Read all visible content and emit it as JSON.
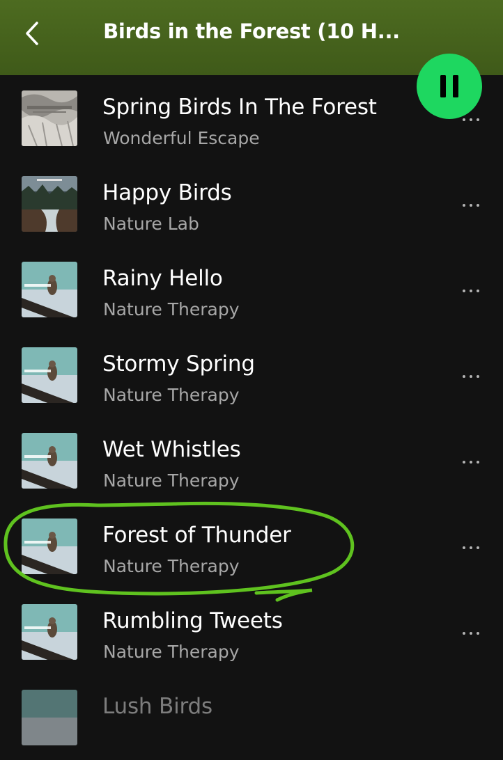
{
  "header": {
    "title": "Birds in the Forest (10 H...",
    "back_icon": "chevron-left-icon",
    "background": "#4a6a1e"
  },
  "player": {
    "pause_icon": "pause-icon",
    "accent": "#1ed760"
  },
  "tracks": [
    {
      "title": "Spring Birds In The Forest",
      "artist": "Wonderful Escape",
      "artwork": "waterfall-cover"
    },
    {
      "title": "Happy Birds",
      "artist": "Nature Lab",
      "artwork": "forest-river-cover"
    },
    {
      "title": "Rainy Hello",
      "artist": "Nature Therapy",
      "artwork": "stormy-tweets-cover"
    },
    {
      "title": "Stormy Spring",
      "artist": "Nature Therapy",
      "artwork": "stormy-tweets-cover"
    },
    {
      "title": "Wet Whistles",
      "artist": "Nature Therapy",
      "artwork": "stormy-tweets-cover"
    },
    {
      "title": "Forest of Thunder",
      "artist": "Nature Therapy",
      "artwork": "stormy-tweets-cover",
      "highlighted": true
    },
    {
      "title": "Rumbling Tweets",
      "artist": "Nature Therapy",
      "artwork": "stormy-tweets-cover"
    },
    {
      "title": "Lush Birds",
      "artist": "",
      "artwork": "stormy-tweets-cover"
    }
  ],
  "more_icon": "more-options-icon",
  "annotation_color": "#5fc21f"
}
